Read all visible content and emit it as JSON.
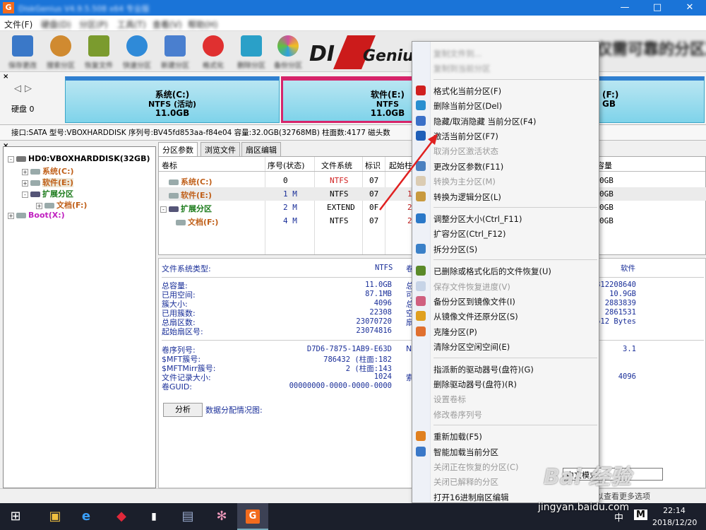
{
  "title_bar": {
    "title": "DiskGenius V4.9.5.508 x64 专业版",
    "app_icon": "G"
  },
  "menu": [
    "文件(F)",
    "硬盘(D)",
    "分区(P)",
    "工具(T)",
    "查看(V)",
    "帮助(H)"
  ],
  "toolbar": [
    {
      "label": "保存更改",
      "icon": "save-icon",
      "color": "#3a78c8"
    },
    {
      "label": "搜索分区",
      "icon": "search-icon",
      "color": "#d08a30"
    },
    {
      "label": "恢复文件",
      "icon": "recover-icon",
      "color": "#7b9b2e"
    },
    {
      "label": "快速分区",
      "icon": "quick-partition-icon",
      "color": "#2f8ad8"
    },
    {
      "label": "新建分区",
      "icon": "new-partition-icon",
      "color": "#4a7fcf"
    },
    {
      "label": "格式化",
      "icon": "format-icon",
      "color": "#e03030"
    },
    {
      "label": "删除分区",
      "icon": "delete-icon",
      "color": "#2aa0c8"
    },
    {
      "label": "备份分区",
      "icon": "backup-icon",
      "color": "#d04fa0"
    }
  ],
  "banner": "仅需可靠的分区工具",
  "partitions": [
    {
      "name": "系统(C:)",
      "fs": "NTFS (活动)",
      "size": "11.0GB"
    },
    {
      "name": "软件(E:)",
      "fs": "NTFS",
      "size": "11.0GB"
    },
    {
      "name": "(F:)",
      "fs": "",
      "size": "GB"
    }
  ],
  "disk_label": "硬盘 0",
  "disk_info": "接口:SATA  型号:VBOXHARDDISK  序列号:BV45fd853aa-f84e04  容量:32.0GB(32768MB)  柱面数:4177  磁头数",
  "tree": {
    "disk": "HD0:VBOXHARDDISK(32GB)",
    "items": [
      {
        "label": "系统(C:)",
        "color": "#c0601a"
      },
      {
        "label": "软件(E:)",
        "color": "#c0601a"
      },
      {
        "label": "扩展分区",
        "color": "#1a7a1a"
      },
      {
        "label": "文档(F:)",
        "color": "#c0601a"
      },
      {
        "label": "Boot(X:)",
        "color": "#c020c0"
      }
    ]
  },
  "tabs": [
    "分区参数",
    "浏览文件",
    "扇区编辑"
  ],
  "table": {
    "headers": [
      "卷标",
      "序号(状态)",
      "文件系统",
      "标识",
      "起始柱",
      "容量"
    ],
    "rows": [
      {
        "label": "系统(C:)",
        "seq": "0",
        "fs": "NTFS",
        "id": "07",
        "start": "",
        "cap": "0GB"
      },
      {
        "label": "软件(E:)",
        "seq": "1 M",
        "fs": "NTFS",
        "id": "07",
        "start": "1",
        "cap": "0GB"
      },
      {
        "label": "扩展分区",
        "seq": "2 M",
        "fs": "EXTEND",
        "id": "0F",
        "start": "2",
        "cap": "0GB"
      },
      {
        "label": "文档(F:)",
        "seq": "4 M",
        "fs": "NTFS",
        "id": "07",
        "start": "2",
        "cap": "0GB"
      }
    ]
  },
  "details": {
    "fs_type_label": "文件系统类型:",
    "fs_type_value": "NTFS",
    "fs_right_value": "软件",
    "left_col_fragment": "卷",
    "labels": [
      "总容量:",
      "已用空间:",
      "簇大小:",
      "已用簇数:",
      "总扇区数:",
      "起始扇区号:"
    ],
    "values": [
      "11.0GB",
      "87.1MB",
      "4096",
      "22308",
      "23070720",
      "23074816"
    ],
    "mid_labels": [
      "总",
      "可",
      "总",
      "空",
      "扇",
      ""
    ],
    "right_values": [
      "812208640",
      "10.9GB",
      "2883839",
      "2861531",
      "512 Bytes",
      ""
    ],
    "labels2": [
      "卷序列号:",
      "$MFT簇号:",
      "$MFTMirr簇号:",
      "文件记录大小:",
      "卷GUID:"
    ],
    "values2": [
      "D7D6-7875-1AB9-E63D",
      "786432 (柱面:182",
      "2 (柱面:143",
      "1024",
      "00000000-0000-0000-0000"
    ],
    "mid_labels2": [
      "NT",
      "",
      "",
      "索",
      ""
    ],
    "right_values2": [
      "3.1",
      "",
      "",
      "4096",
      ""
    ],
    "analyze_button": "分析",
    "alloc_label": "数据分配情况图:"
  },
  "context_menu": [
    {
      "label": "复制文件到...",
      "disabled": true,
      "icon": "",
      "blurred": true
    },
    {
      "label": "复制到当前分区",
      "disabled": true,
      "icon": "",
      "blurred": true
    },
    {
      "sep": true
    },
    {
      "label": "格式化当前分区(F)",
      "disabled": false,
      "icon": "format-icon",
      "color": "#d02020"
    },
    {
      "label": "删除当前分区(Del)",
      "disabled": false,
      "icon": "delete-icon",
      "color": "#2a8fd0"
    },
    {
      "label": "隐藏/取消隐藏 当前分区(F4)",
      "disabled": false,
      "icon": "hide-icon",
      "color": "#3a70c8"
    },
    {
      "label": "激活当前分区(F7)",
      "disabled": false,
      "icon": "activate-icon",
      "color": "#1f5fb8"
    },
    {
      "label": "取消分区激活状态",
      "disabled": true,
      "icon": "",
      "color": ""
    },
    {
      "label": "更改分区参数(F11)",
      "disabled": false,
      "icon": "params-icon",
      "color": "#4a80c0"
    },
    {
      "label": "转换为主分区(M)",
      "disabled": true,
      "icon": "primary-icon",
      "color": "#c8a870"
    },
    {
      "label": "转换为逻辑分区(L)",
      "disabled": false,
      "icon": "logical-icon",
      "color": "#c89a40"
    },
    {
      "sep": true
    },
    {
      "label": "调整分区大小(Ctrl_F11)",
      "disabled": false,
      "icon": "resize-icon",
      "color": "#2a78c8"
    },
    {
      "label": "扩容分区(Ctrl_F12)",
      "disabled": false,
      "icon": "",
      "color": ""
    },
    {
      "label": "拆分分区(S)",
      "disabled": false,
      "icon": "split-icon",
      "color": "#3a80c8"
    },
    {
      "sep": true
    },
    {
      "label": "已删除或格式化后的文件恢复(U)",
      "disabled": false,
      "icon": "recover-icon",
      "color": "#5a8a2a"
    },
    {
      "label": "保存文件恢复进度(V)",
      "disabled": true,
      "icon": "save-progress-icon",
      "color": "#a0b8d8"
    },
    {
      "label": "备份分区到镜像文件(I)",
      "disabled": false,
      "icon": "backup-icon",
      "color": "#d06080"
    },
    {
      "label": "从镜像文件还原分区(S)",
      "disabled": false,
      "icon": "restore-icon",
      "color": "#e0a020"
    },
    {
      "label": "克隆分区(P)",
      "disabled": false,
      "icon": "clone-icon",
      "color": "#e07030"
    },
    {
      "label": "清除分区空闲空间(E)",
      "disabled": false,
      "icon": "",
      "color": ""
    },
    {
      "sep": true
    },
    {
      "label": "指派新的驱动器号(盘符)(G)",
      "disabled": false,
      "icon": "",
      "color": ""
    },
    {
      "label": "删除驱动器号(盘符)(R)",
      "disabled": false,
      "icon": "",
      "color": ""
    },
    {
      "label": "设置卷标",
      "disabled": true,
      "icon": "",
      "color": ""
    },
    {
      "label": "修改卷序列号",
      "disabled": true,
      "icon": "",
      "color": ""
    },
    {
      "sep": true
    },
    {
      "label": "重新加载(F5)",
      "disabled": false,
      "icon": "reload-icon",
      "color": "#e08020"
    },
    {
      "label": "智能加载当前分区",
      "disabled": false,
      "icon": "smart-load-icon",
      "color": "#3a78c8"
    },
    {
      "label": "关闭正在恢复的分区(C)",
      "disabled": true,
      "icon": "",
      "color": ""
    },
    {
      "label": "关闭已解释的分区",
      "disabled": true,
      "icon": "",
      "color": ""
    },
    {
      "label": "打开16进制扇区编辑",
      "disabled": false,
      "icon": "",
      "color": ""
    }
  ],
  "tooltip": "中文模式",
  "status_text": "单击右键以查看更多选项",
  "taskbar": {
    "apps": [
      "windows-start-icon",
      "file-explorer-icon",
      "edge-icon",
      "app-red-icon",
      "terminal-icon",
      "network-icon",
      "paint-icon",
      "diskgenius-icon"
    ],
    "ime": "中",
    "ime2": "M",
    "time": "22:14",
    "date": "2018/12/20"
  },
  "watermark": "Bai 经验",
  "watermark_url": "jingyan.baidu.com"
}
